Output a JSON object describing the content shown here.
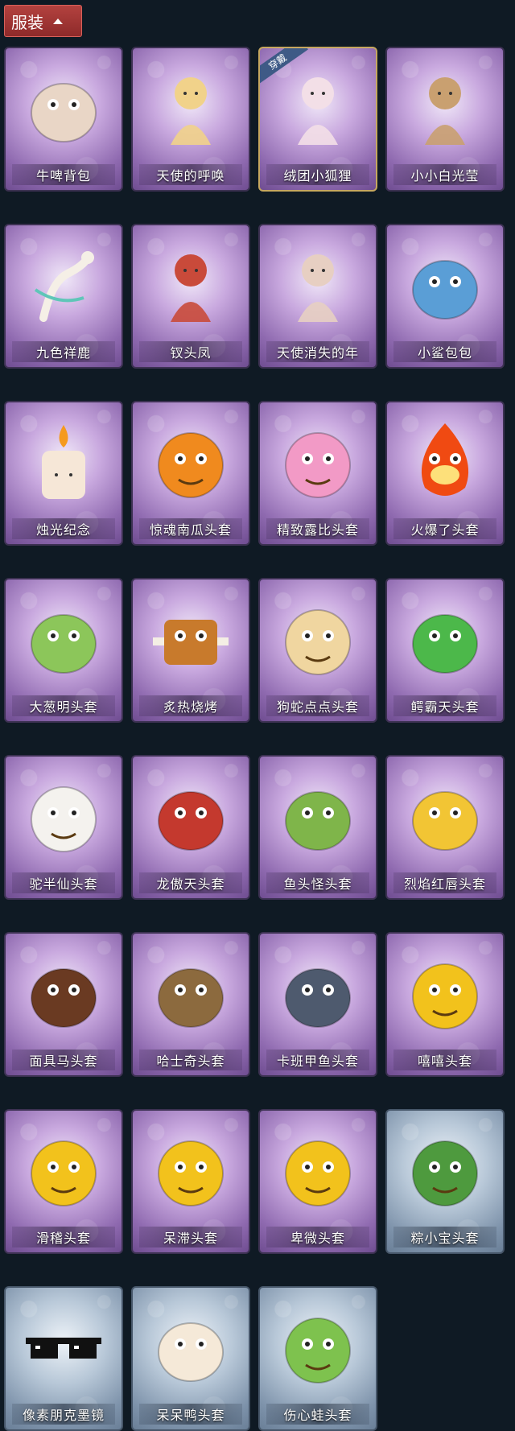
{
  "header": {
    "label": "服装"
  },
  "items": [
    {
      "label": "牛啤背包",
      "color": "#e9d6c6",
      "theme": "purple",
      "shape": "blob"
    },
    {
      "label": "天使的呼唤",
      "color": "#f1d28a",
      "theme": "purple",
      "shape": "figure"
    },
    {
      "label": "绒团小狐狸",
      "color": "#f3dfe7",
      "theme": "purple",
      "shape": "figure",
      "selected": true,
      "badge": "穿戴"
    },
    {
      "label": "小小白光莹",
      "color": "#c9a070",
      "theme": "purple",
      "shape": "figure"
    },
    {
      "label": "九色祥鹿",
      "color": "#f5efe6",
      "theme": "purple",
      "shape": "deer"
    },
    {
      "label": "钗头凤",
      "color": "#c94a3a",
      "theme": "purple",
      "shape": "figure"
    },
    {
      "label": "天使消失的年",
      "color": "#e7cfc2",
      "theme": "purple",
      "shape": "figure"
    },
    {
      "label": "小鲨包包",
      "color": "#5a9ed6",
      "theme": "purple",
      "shape": "blob"
    },
    {
      "label": "烛光纪念",
      "color": "#f6e7d7",
      "theme": "purple",
      "shape": "candle"
    },
    {
      "label": "惊魂南瓜头套",
      "color": "#f08a1e",
      "theme": "purple",
      "shape": "ball"
    },
    {
      "label": "精致露比头套",
      "color": "#f29ac6",
      "theme": "purple",
      "shape": "ball"
    },
    {
      "label": "火爆了头套",
      "color": "#f04a12",
      "theme": "purple",
      "shape": "flame"
    },
    {
      "label": "大葱明头套",
      "color": "#8cc65a",
      "theme": "purple",
      "shape": "blob"
    },
    {
      "label": "炙热烧烤",
      "color": "#c87a2c",
      "theme": "purple",
      "shape": "box"
    },
    {
      "label": "狗蛇点点头套",
      "color": "#f0d6a0",
      "theme": "purple",
      "shape": "ball"
    },
    {
      "label": "鳄霸天头套",
      "color": "#4cb84a",
      "theme": "purple",
      "shape": "blob"
    },
    {
      "label": "驼半仙头套",
      "color": "#f4f2ee",
      "theme": "purple",
      "shape": "ball"
    },
    {
      "label": "龙傲天头套",
      "color": "#c4392e",
      "theme": "purple",
      "shape": "blob"
    },
    {
      "label": "鱼头怪头套",
      "color": "#7fb54a",
      "theme": "purple",
      "shape": "blob"
    },
    {
      "label": "烈焰红唇头套",
      "color": "#f2c534",
      "theme": "purple",
      "shape": "blob"
    },
    {
      "label": "面具马头套",
      "color": "#6a3a22",
      "theme": "purple",
      "shape": "blob"
    },
    {
      "label": "哈士奇头套",
      "color": "#8c6a3e",
      "theme": "purple",
      "shape": "blob"
    },
    {
      "label": "卡班甲鱼头套",
      "color": "#4e5a6e",
      "theme": "purple",
      "shape": "blob"
    },
    {
      "label": "嘻嘻头套",
      "color": "#f2c21c",
      "theme": "purple",
      "shape": "ball"
    },
    {
      "label": "滑稽头套",
      "color": "#f2c21c",
      "theme": "purple",
      "shape": "ball"
    },
    {
      "label": "呆滞头套",
      "color": "#f2c21c",
      "theme": "purple",
      "shape": "ball"
    },
    {
      "label": "卑微头套",
      "color": "#f2c21c",
      "theme": "purple",
      "shape": "ball"
    },
    {
      "label": "粽小宝头套",
      "color": "#4e9a3e",
      "theme": "blue",
      "shape": "ball"
    },
    {
      "label": "像素朋克墨镜",
      "color": "#111111",
      "theme": "blue",
      "shape": "glasses"
    },
    {
      "label": "呆呆鸭头套",
      "color": "#f5e9d8",
      "theme": "blue",
      "shape": "blob"
    },
    {
      "label": "伤心蛙头套",
      "color": "#7ec24e",
      "theme": "blue",
      "shape": "ball"
    }
  ]
}
